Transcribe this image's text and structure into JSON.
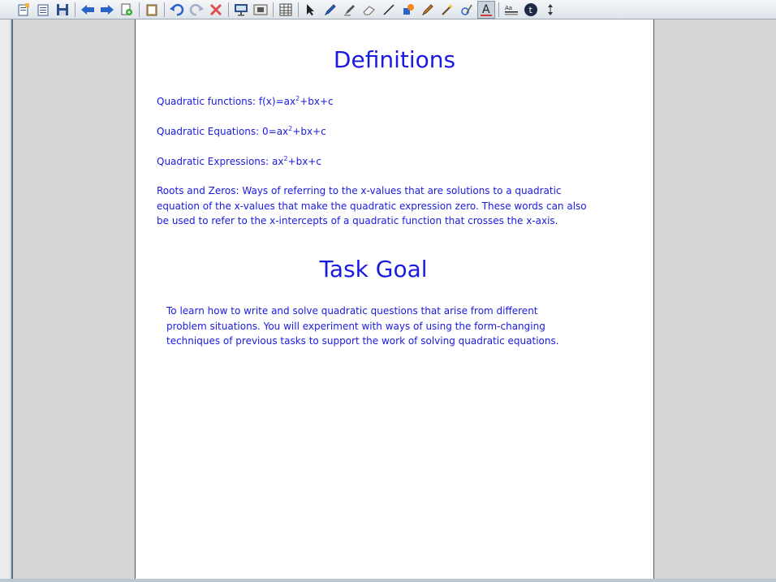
{
  "toolbar": {
    "icons": [
      "new-page-icon",
      "page-list-icon",
      "save-icon",
      "back-arrow-icon",
      "forward-arrow-icon",
      "add-page-icon",
      "clipboard-icon",
      "undo-icon",
      "redo-icon",
      "delete-icon",
      "projector-icon",
      "capture-icon",
      "table-icon",
      "select-arrow-icon",
      "pen-icon",
      "highlighter-icon",
      "eraser-icon",
      "line-icon",
      "fill-icon",
      "magic-pen-icon",
      "magic-wand-icon",
      "shape-recognition-icon",
      "text-icon",
      "properties-icon",
      "info-icon",
      "move-toolbar-icon"
    ]
  },
  "definitions": {
    "title": "Definitions",
    "functions": {
      "prefix": "Quadratic functions: f(x)=ax",
      "sup": "2",
      "suffix": "+bx+c"
    },
    "equations": {
      "prefix": "Quadratic Equations: 0=ax",
      "sup": "2",
      "suffix": "+bx+c"
    },
    "expressions": {
      "prefix": "Quadratic Expressions: ax",
      "sup": "2",
      "suffix": "+bx+c"
    },
    "roots_lines": [
      "Roots and Zeros: Ways of referring to the x-values that are solutions to a quadratic",
      "equation of the x-values that make the quadratic expression zero.  These words can also",
      "be used to refer to the x-intercepts of a quadratic function that crosses the x-axis."
    ]
  },
  "task_goal": {
    "title": "Task Goal",
    "lines": [
      "To learn how to write and solve quadratic questions that arise from different",
      "problem situations.  You will experiment with ways of using the form-changing",
      "techniques of previous tasks to support the work of solving quadratic equations."
    ]
  },
  "colors": {
    "text": "#1a1ae0",
    "page": "#ffffff",
    "background": "#d6d6d6"
  }
}
